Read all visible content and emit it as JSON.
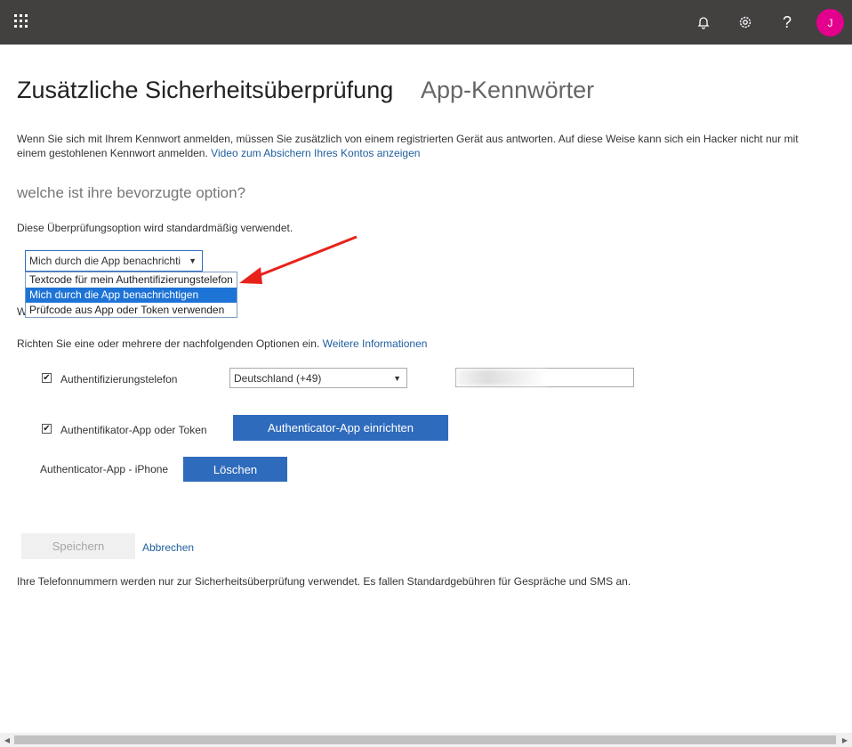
{
  "topbar": {
    "icons": [
      "app-launcher-icon",
      "bell-icon",
      "gear-icon",
      "help-icon"
    ],
    "help_glyph": "?",
    "avatar_initial": "J",
    "colors": {
      "bar": "#434040",
      "avatar": "#e3008c"
    }
  },
  "header": {
    "title": "Zusätzliche Sicherheitsüberprüfung",
    "tab_app_passwords": "App-Kennwörter"
  },
  "intro": {
    "line1": "Wenn Sie sich mit Ihrem Kennwort anmelden, müssen Sie zusätzlich von einem registrierten Gerät aus antworten. Auf diese Weise kann sich ein Hacker nicht nur mit",
    "line2": "einem gestohlenen Kennwort anmelden.",
    "video_link": "Video zum Absichern Ihres Kontos anzeigen"
  },
  "option_section": {
    "heading": "welche ist ihre bevorzugte option?",
    "description": "Diese Überprüfungsoption wird standardmäßig verwendet.",
    "select_value": "Mich durch die App benachrichti",
    "options": [
      "Textcode für mein Authentifizierungstelefon",
      "Mich durch die App benachrichtigen",
      "Prüfcode aus App oder Token verwenden"
    ],
    "hidden_text_start": "W"
  },
  "methods": {
    "description": "Richten Sie eine oder mehrere der nachfolgenden Optionen ein.",
    "more_info_link": "Weitere Informationen",
    "phone_label": "Authentifizierungstelefon",
    "phone_checked": true,
    "country_value": "Deutschland (+49)",
    "app_label": "Authentifikator-App oder Token",
    "app_checked": true,
    "setup_button": "Authenticator-App einrichten",
    "device_label": "Authenticator-App - iPhone",
    "delete_button": "Löschen"
  },
  "footer": {
    "save_button": "Speichern",
    "cancel_link": "Abbrechen",
    "note": "Ihre Telefonnummern werden nur zur Sicherheitsüberprüfung verwendet. Es fallen Standardgebühren für Gespräche und SMS an."
  },
  "accent_color": "#2f6bbc",
  "annotation_color": "#e8221b"
}
